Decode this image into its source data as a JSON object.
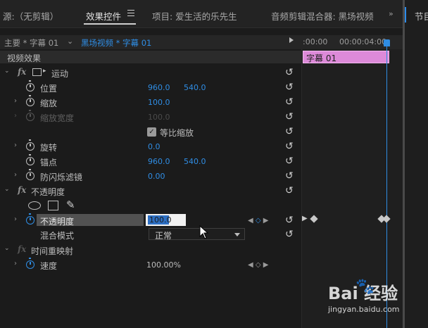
{
  "tabs": {
    "source": "源:（无剪辑）",
    "effect_controls": "效果控件",
    "project": "项目: 爱生活的乐先生",
    "audio_mixer": "音频剪辑混合器: 黑场视频",
    "program": "节目",
    "overflow": "»"
  },
  "header": {
    "source_clip": "主要 * 字幕 01",
    "sequence_clip": "黑场视频 * 字幕 01",
    "time_start": ":00:00",
    "time_end": "00:00:04:00"
  },
  "timeline": {
    "clip_label": "字幕 01"
  },
  "section": {
    "video_effects": "视频效果"
  },
  "motion": {
    "name": "运动",
    "position_label": "位置",
    "position_x": "960.0",
    "position_y": "540.0",
    "scale_label": "缩放",
    "scale_value": "100.0",
    "scale_width_label": "缩放宽度",
    "scale_width_value": "100.0",
    "uniform_scale_label": "等比缩放",
    "rotation_label": "旋转",
    "rotation_value": "0.0",
    "anchor_label": "锚点",
    "anchor_x": "960.0",
    "anchor_y": "540.0",
    "antiflicker_label": "防闪烁滤镜",
    "antiflicker_value": "0.00"
  },
  "opacity": {
    "name": "不透明度",
    "opacity_label": "不透明度",
    "opacity_value": "100.0",
    "blend_label": "混合模式",
    "blend_value": "正常"
  },
  "time_remap": {
    "name": "时间重映射",
    "speed_label": "速度",
    "speed_value": "100.00%"
  },
  "watermark": {
    "brand": "Bai  经验",
    "url": "jingyan.baidu.com"
  },
  "colors": {
    "accent": "#2f8de4",
    "clip": "#dd8ad9"
  }
}
